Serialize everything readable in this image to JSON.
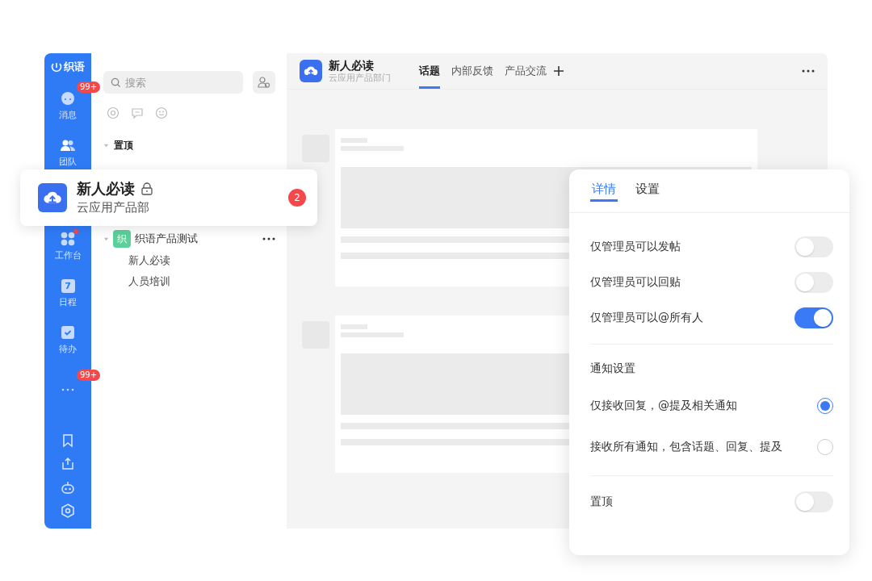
{
  "rail": {
    "logo": "织语",
    "items": [
      {
        "kind": "chat",
        "label": "消息",
        "badge": "99+",
        "dot": false
      },
      {
        "kind": "team",
        "label": "团队",
        "dot": false
      },
      {
        "kind": "hidden"
      },
      {
        "kind": "apps",
        "label": "工作台",
        "dot": true
      },
      {
        "kind": "calendar",
        "label": "日程",
        "icon_text": "7",
        "dot": false
      },
      {
        "kind": "todo",
        "label": "待办",
        "dot": false
      },
      {
        "kind": "more",
        "badge": "99+",
        "dot": false
      }
    ]
  },
  "channel_list": {
    "search": {
      "placeholder": "搜索"
    },
    "sections": [
      {
        "kind": "pinned",
        "title": "置顶",
        "expanded": true
      },
      {
        "kind": "group",
        "title": "织语产品测试",
        "avatar": "织",
        "expanded": true,
        "children": [
          {
            "label": "新人必读"
          },
          {
            "label": "人员培训"
          }
        ]
      }
    ]
  },
  "header": {
    "title": "新人必读",
    "subtitle": "云应用产品部门",
    "tabs": [
      {
        "label": "话题",
        "selected": true
      },
      {
        "label": "内部反馈",
        "selected": false
      },
      {
        "label": "产品交流",
        "selected": false
      }
    ]
  },
  "popup_card": {
    "title": "新人必读",
    "subtitle": "云应用产品部",
    "badge": "2"
  },
  "settings_panel": {
    "tabs": [
      {
        "label": "详情",
        "selected": true
      },
      {
        "label": "设置",
        "selected": false
      }
    ],
    "permissions": [
      {
        "label": "仅管理员可以发帖",
        "on": false
      },
      {
        "label": "仅管理员可以回贴",
        "on": false
      },
      {
        "label": "仅管理员可以@所有人",
        "on": true
      }
    ],
    "notifications": {
      "title": "通知设置",
      "options": [
        {
          "label": "仅接收回复，@提及相关通知",
          "selected": true
        },
        {
          "label": "接收所有通知，包含话题、回复、提及",
          "selected": false
        }
      ]
    },
    "pin": {
      "label": "置顶",
      "on": false
    }
  }
}
